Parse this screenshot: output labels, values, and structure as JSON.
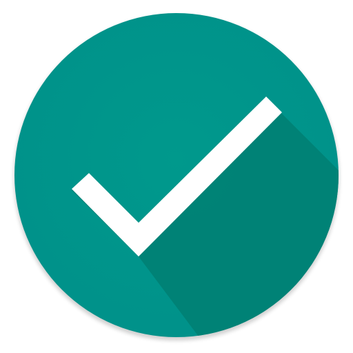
{
  "icon": {
    "name": "check-circle-icon",
    "colors": {
      "circle": "#00968a",
      "circle_edge": "#00897b",
      "long_shadow": "#007f72",
      "check": "#ffffff"
    }
  }
}
